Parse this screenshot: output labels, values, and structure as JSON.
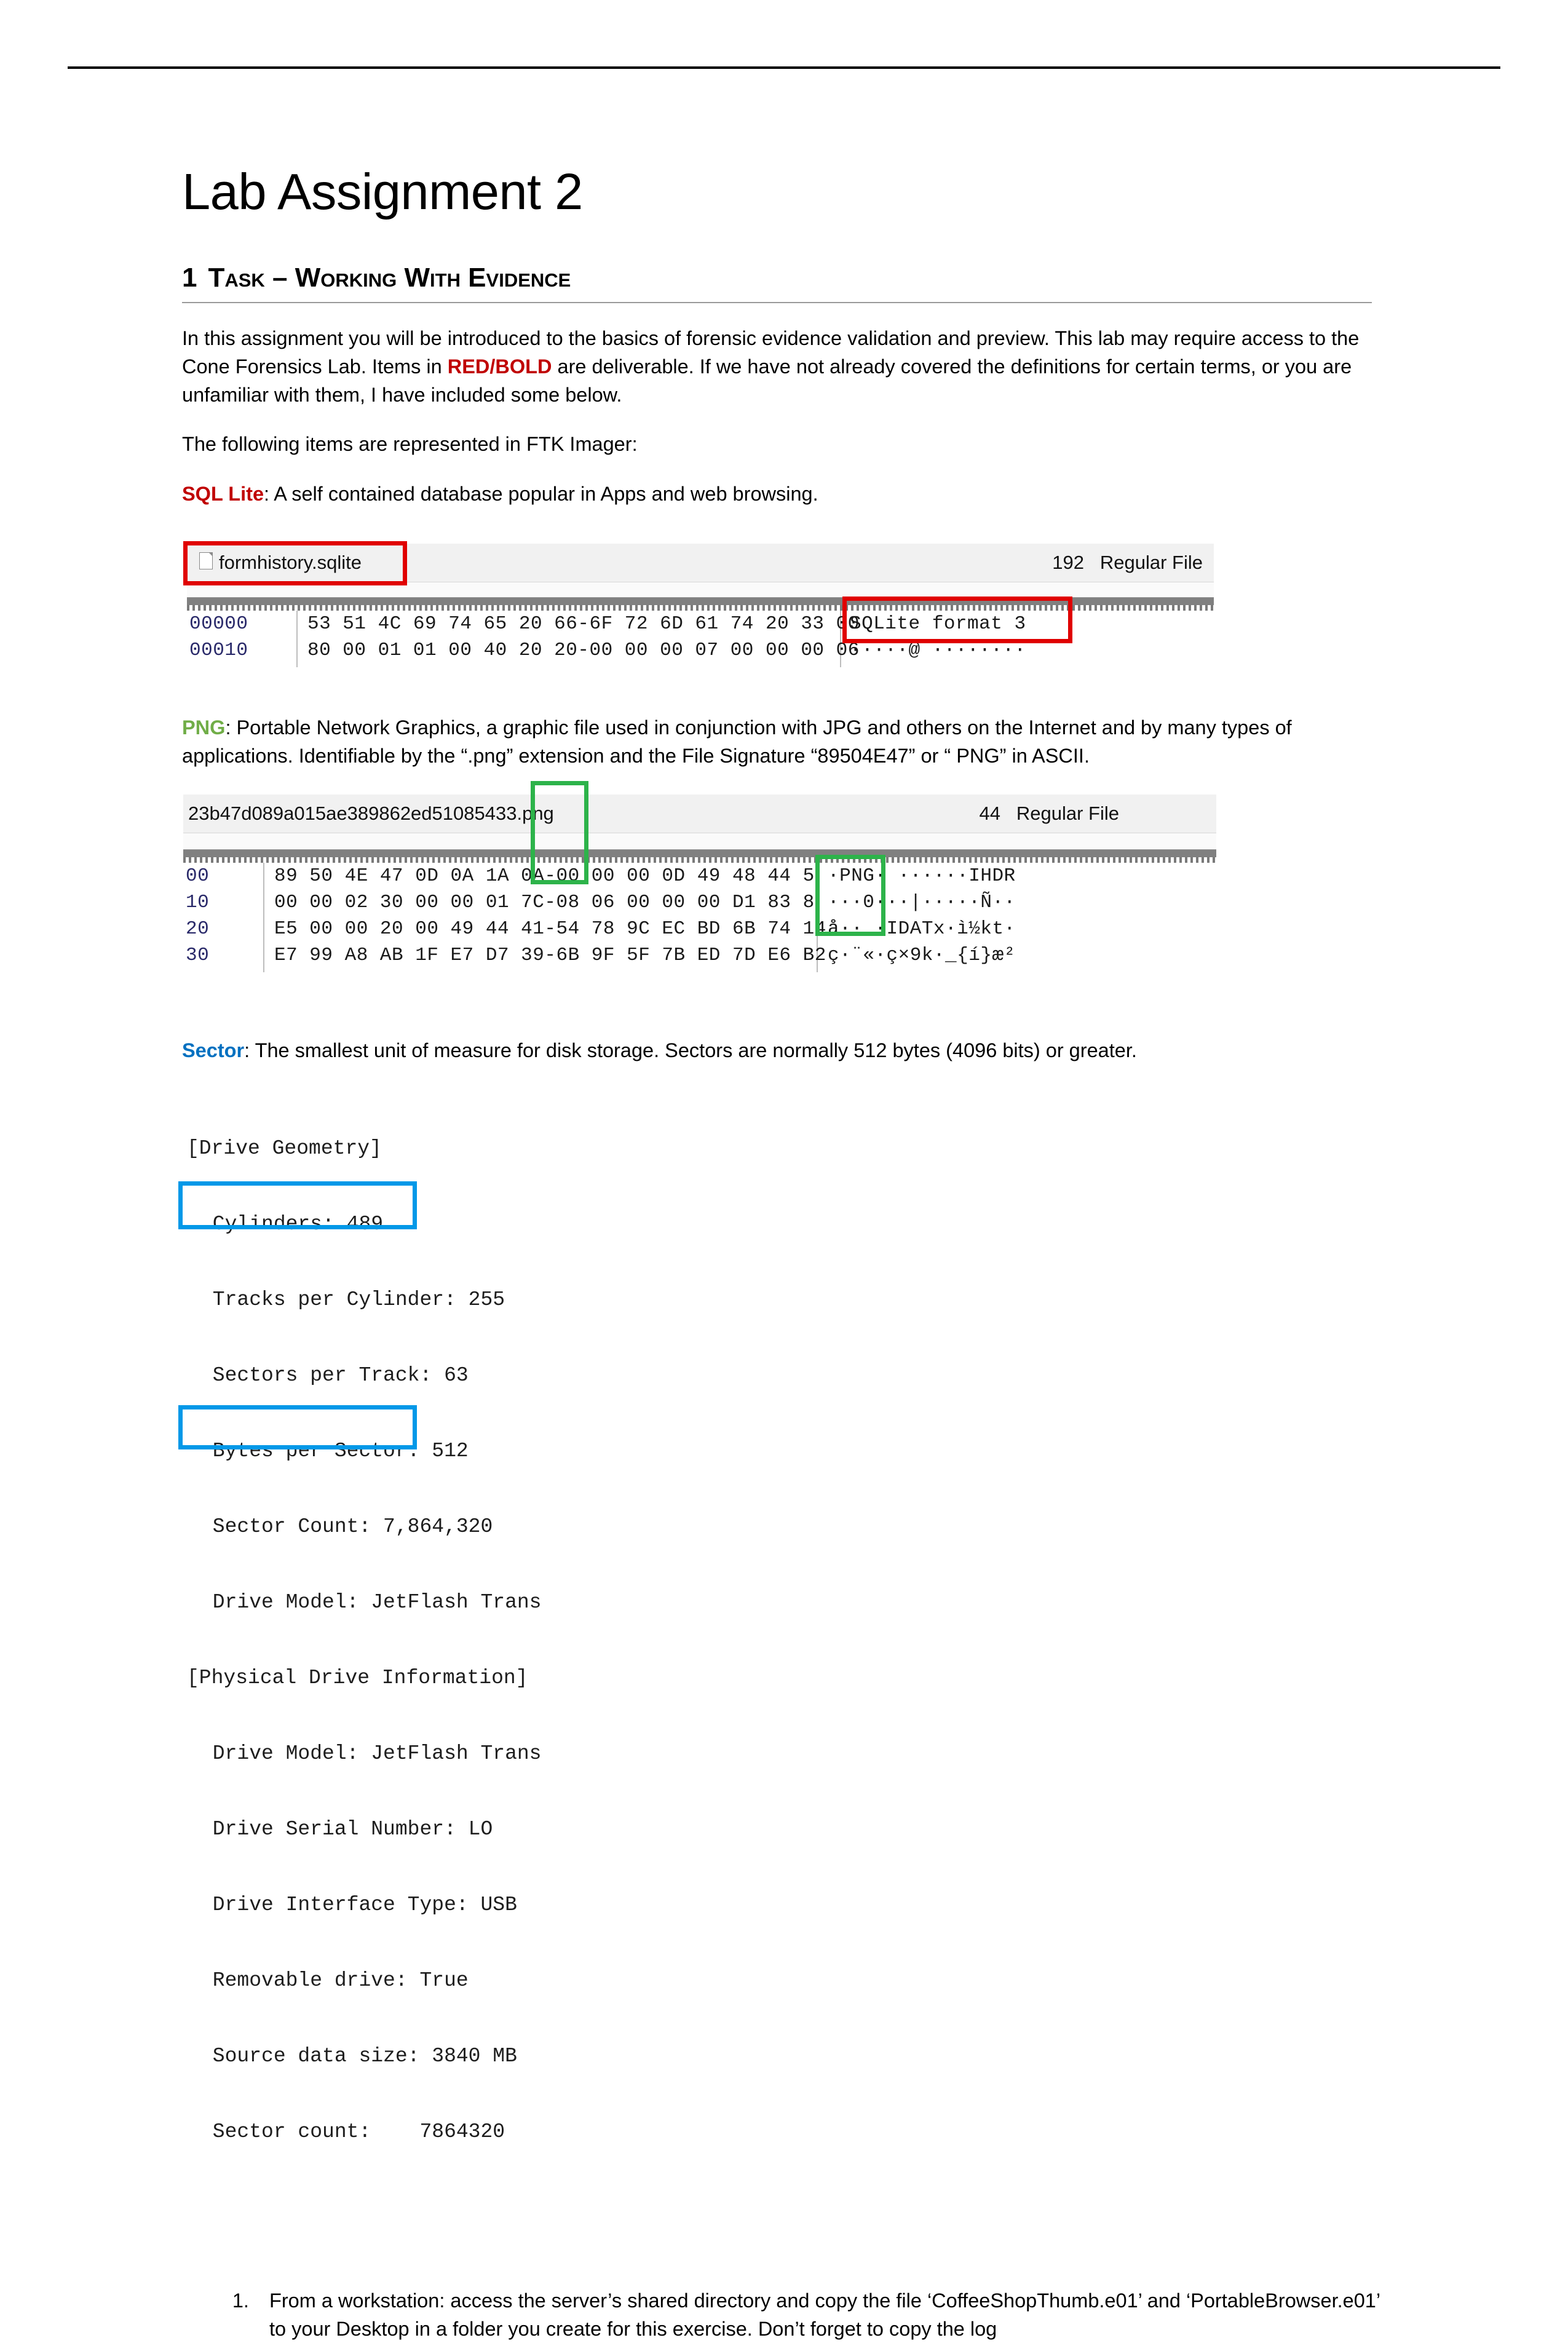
{
  "document": {
    "title": "Lab Assignment 2",
    "section": {
      "number": "1",
      "heading": "Task – Working with evidence"
    },
    "intro_paragraph": {
      "part1": "In this assignment you will be introduced to the basics of forensic evidence validation and preview. This lab may require access to the Cone Forensics Lab. Items in ",
      "emphasis": "RED/BOLD",
      "part2": " are deliverable. If we have not already covered the definitions for certain terms, or you are unfamiliar with them, I have included some below."
    },
    "lead_in": " The following items are represented in FTK Imager:"
  },
  "terms": {
    "sqlite": {
      "name": "SQL Lite",
      "color": "#C00000",
      "definition": ": A self contained database popular in Apps and web browsing."
    },
    "png": {
      "name": "PNG",
      "color": "#70AD47",
      "definition": ": Portable Network Graphics, a graphic file used in conjunction with JPG and others on the Internet and by many types of applications. Identifiable by the “.png” extension and the File Signature “89504E47” or “ PNG” in ASCII."
    },
    "sector": {
      "name": "Sector",
      "color": "#0070C0",
      "definition": ": The smallest unit of measure for disk storage. Sectors are normally 512 bytes (4096 bits) or greater."
    }
  },
  "sqlite_screenshot": {
    "file_name": "formhistory.sqlite",
    "file_size": "192",
    "file_type": "Regular File",
    "hex_rows": [
      {
        "offset": "00000",
        "bytes": "53 51 4C 69 74 65 20 66-6F 72 6D 61 74 20 33 00",
        "ascii": "SQLite format 3"
      },
      {
        "offset": "00010",
        "bytes": "80 00 01 01 00 40 20 20-00 00 00 07 00 00 00 06",
        "ascii": "·····@  ········"
      }
    ],
    "annotations": [
      {
        "label": "filename-highlight",
        "color": "#E00000"
      },
      {
        "label": "ascii-signature-highlight",
        "color": "#E00000"
      }
    ]
  },
  "png_screenshot": {
    "file_name_prefix": "23b47d089a015ae389862ed510854",
    "file_name_suffix": "33.png",
    "file_size": "44",
    "file_type": "Regular File",
    "hex_rows": [
      {
        "offset": "00",
        "bytes": "89 50 4E 47 0D 0A 1A 0A-00 00 00 0D 49 48 44 5",
        "ascii": "·PNG· ······IHDR"
      },
      {
        "offset": "10",
        "bytes": "00 00 02 30 00 00 01 7C-08 06 00 00 00 D1 83 8",
        "ascii": "···0···|·····Ñ··"
      },
      {
        "offset": "20",
        "bytes": "E5 00 00 20 00 49 44 41-54 78 9C EC BD 6B 74 14",
        "ascii": "å··  ·IDATx·ì½kt·"
      },
      {
        "offset": "30",
        "bytes": "E7 99 A8 AB 1F E7 D7 39-6B 9F 5F 7B ED 7D E6 B2",
        "ascii": "ç·¨«·ç×9k·_{í}æ²"
      }
    ],
    "annotations": [
      {
        "label": "filename-extension-highlight",
        "color": "#2DB34A"
      },
      {
        "label": "ascii-png-signature-highlight",
        "color": "#2DB34A"
      }
    ]
  },
  "drive_info_screenshot": {
    "lines": [
      "[Drive Geometry]",
      " Cylinders: 489",
      " Tracks per Cylinder: 255",
      " Sectors per Track: 63",
      " Bytes per Sector: 512",
      " Sector Count: 7,864,320",
      " Drive Model: JetFlash Trans",
      "[Physical Drive Information]",
      " Drive Model: JetFlash Trans",
      " Drive Serial Number: LO",
      " Drive Interface Type: USB",
      " Removable drive: True",
      " Source data size: 3840 MB",
      " Sector count:    7864320"
    ],
    "annotations": [
      {
        "label": "bytes-per-sector-highlight",
        "color": "#0098E8"
      },
      {
        "label": "sector-count-highlight",
        "color": "#0098E8"
      }
    ]
  },
  "tasks": [
    {
      "number": "1)",
      "text": "From a workstation: access the server’s shared directory and copy the file ‘CoffeeShopThumb.e01’  and ‘PortableBrowser.e01’ to your Desktop in a folder you create for this exercise. Don’t forget to copy the log"
    }
  ]
}
